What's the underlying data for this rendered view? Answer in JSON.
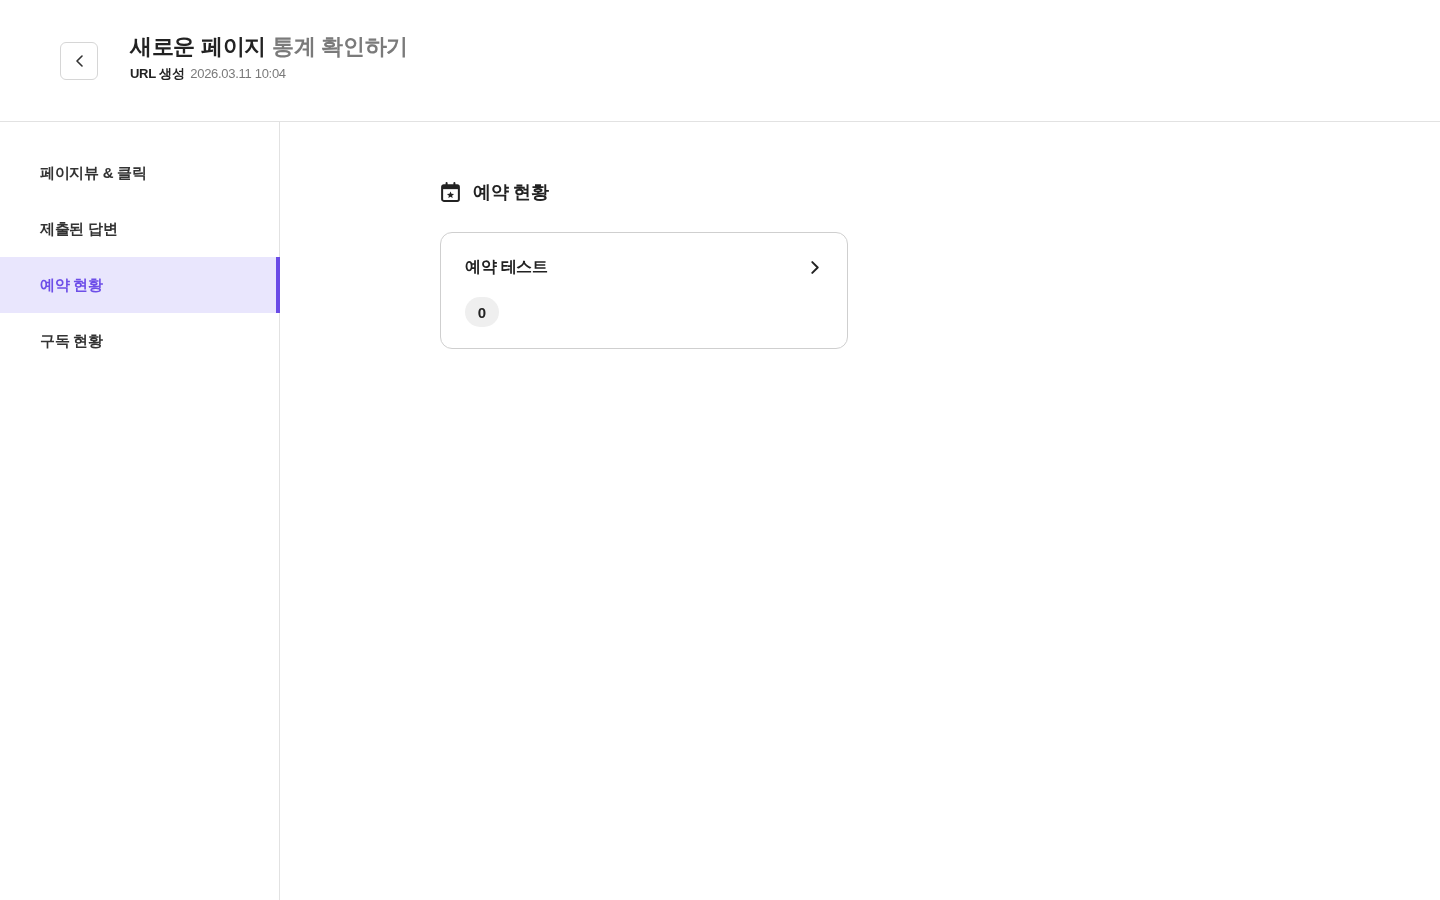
{
  "header": {
    "title": "새로운 페이지",
    "title_suffix": "통계 확인하기",
    "meta_label": "URL 생성",
    "meta_value": "2026.03.11 10:04"
  },
  "sidebar": {
    "items": [
      {
        "label": "페이지뷰 & 클릭",
        "selected": false
      },
      {
        "label": "제출된 답변",
        "selected": false
      },
      {
        "label": "예약 현황",
        "selected": true
      },
      {
        "label": "구독 현황",
        "selected": false
      }
    ]
  },
  "section": {
    "title": "예약 현황",
    "cards": [
      {
        "title": "예약 테스트",
        "count": "0"
      }
    ]
  }
}
